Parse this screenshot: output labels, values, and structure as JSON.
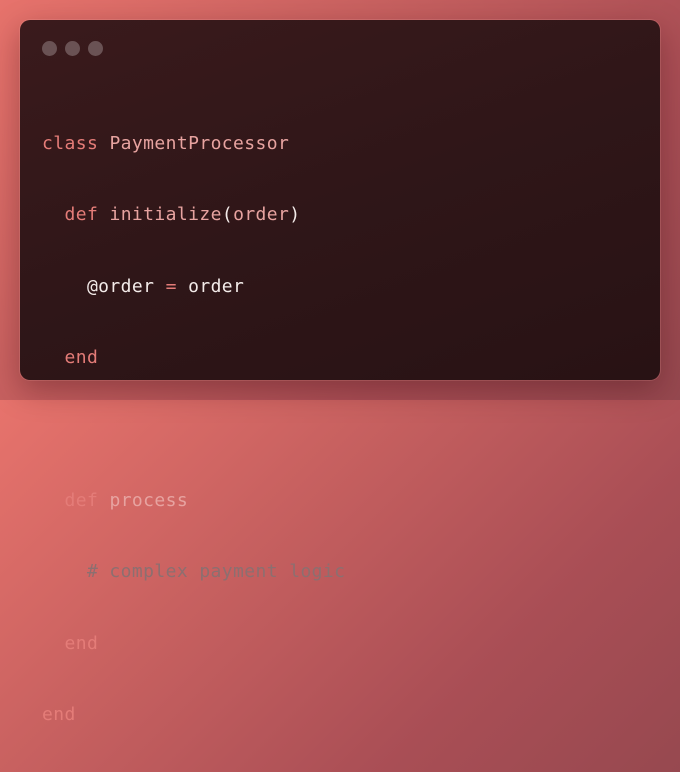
{
  "window": {
    "controls": [
      "window-dot-icon",
      "window-dot-icon",
      "window-dot-icon"
    ]
  },
  "code": {
    "lines": [
      [
        {
          "text": "class",
          "kind": "keyword"
        },
        {
          "text": " ",
          "kind": "plain"
        },
        {
          "text": "PaymentProcessor",
          "kind": "name"
        }
      ],
      [
        {
          "text": "  ",
          "kind": "plain"
        },
        {
          "text": "def",
          "kind": "keyword"
        },
        {
          "text": " ",
          "kind": "plain"
        },
        {
          "text": "initialize",
          "kind": "name"
        },
        {
          "text": "(",
          "kind": "plain"
        },
        {
          "text": "order",
          "kind": "name"
        },
        {
          "text": ")",
          "kind": "plain"
        }
      ],
      [
        {
          "text": "    @order ",
          "kind": "plain"
        },
        {
          "text": "=",
          "kind": "keyword"
        },
        {
          "text": " order",
          "kind": "plain"
        }
      ],
      [
        {
          "text": "  ",
          "kind": "plain"
        },
        {
          "text": "end",
          "kind": "keyword"
        }
      ],
      [],
      [
        {
          "text": "  ",
          "kind": "plain"
        },
        {
          "text": "def",
          "kind": "keyword"
        },
        {
          "text": " ",
          "kind": "plain"
        },
        {
          "text": "process",
          "kind": "name"
        }
      ],
      [
        {
          "text": "    # complex payment logic",
          "kind": "comment"
        }
      ],
      [
        {
          "text": "  ",
          "kind": "plain"
        },
        {
          "text": "end",
          "kind": "keyword"
        }
      ],
      [
        {
          "text": "end",
          "kind": "keyword"
        }
      ]
    ]
  },
  "colors": {
    "keyword": "#e47c78",
    "name": "#e7a3a0",
    "plain": "#f3ebe9",
    "comment": "#8c6f70",
    "window_background": "#2f1618",
    "window_dot": "#6a5254"
  }
}
